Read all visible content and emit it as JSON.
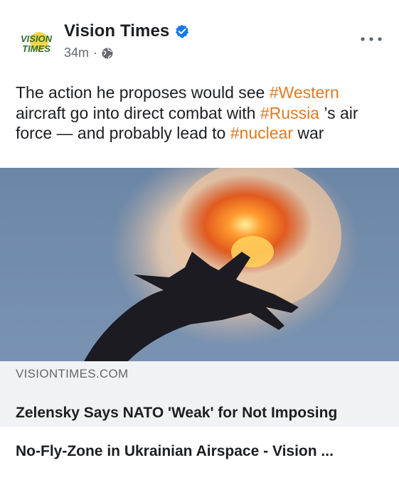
{
  "post": {
    "author": "Vision Times",
    "logo_text_top": "VISION",
    "logo_text_bottom": "TIMES",
    "timestamp": "34m",
    "separator": "·",
    "verified_icon": "verified-badge-icon",
    "privacy_icon": "globe-icon",
    "menu_icon": "more-options-icon",
    "text_segments": [
      {
        "text": "The action he proposes would see ",
        "hashtag": false
      },
      {
        "text": "#Western",
        "hashtag": true
      },
      {
        "text": " aircraft go into direct combat with ",
        "hashtag": false
      },
      {
        "text": "#Russia",
        "hashtag": true
      },
      {
        "text": " ’s air force — and probably lead to ",
        "hashtag": false
      },
      {
        "text": "#nuclear",
        "hashtag": true
      },
      {
        "text": " war",
        "hashtag": false
      }
    ],
    "colors": {
      "hashtag": "#e07a22",
      "verified": "#1877f2",
      "muted": "#65676b",
      "preview_bg": "#f0f2f5"
    }
  },
  "link_preview": {
    "domain": "VISIONTIMES.COM",
    "title_line1": "Zelensky Says NATO 'Weak' for Not Imposing",
    "title_line2": "No-Fly-Zone in Ukrainian Airspace - Vision ..."
  }
}
